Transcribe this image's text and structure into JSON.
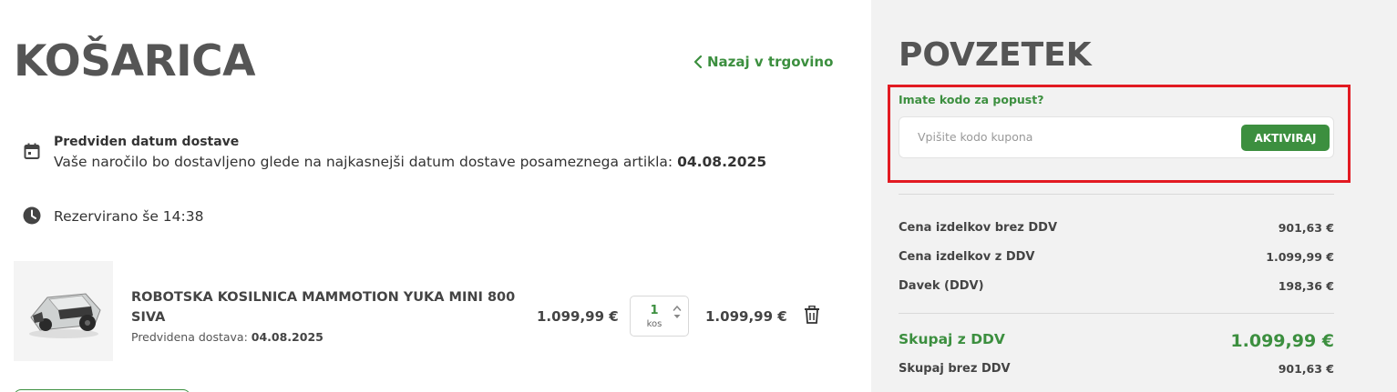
{
  "cart": {
    "title": "KOŠARICA",
    "back_link": "Nazaj v trgovino",
    "delivery": {
      "title": "Predviden datum dostave",
      "text": "Vaše naročilo bo dostavljeno glede na najkasnejši datum dostave posameznega artikla: ",
      "date": "04.08.2025"
    },
    "reserved": "Rezervirano še 14:38",
    "items": [
      {
        "name": "ROBOTSKA KOSILNICA MAMMOTION YUKA MINI 800 SIVA",
        "eta_label": "Predvidena dostava: ",
        "eta_date": "04.08.2025",
        "unit_price": "1.099,99 €",
        "qty": "1",
        "qty_unit": "kos",
        "total_price": "1.099,99 €"
      }
    ]
  },
  "summary": {
    "title": "POVZETEK",
    "coupon": {
      "label": "Imate kodo za popust?",
      "placeholder": "Vpišite kodo kupona",
      "button": "AKTIVIRAJ"
    },
    "rows": [
      {
        "label": "Cena izdelkov brez DDV",
        "value": "901,63 €"
      },
      {
        "label": "Cena izdelkov z DDV",
        "value": "1.099,99 €"
      },
      {
        "label": "Davek (DDV)",
        "value": "198,36 €"
      }
    ],
    "total": {
      "label": "Skupaj z DDV",
      "value": "1.099,99 €"
    },
    "total_no_vat": {
      "label": "Skupaj brez DDV",
      "value": "901,63 €"
    }
  },
  "colors": {
    "accent": "#3c8f3f",
    "highlight": "#e21a22",
    "panel": "#f2f2f2"
  },
  "icons": [
    "chevron-left-icon",
    "calendar-icon",
    "clock-icon",
    "stepper-arrows-icon",
    "trash-icon"
  ]
}
